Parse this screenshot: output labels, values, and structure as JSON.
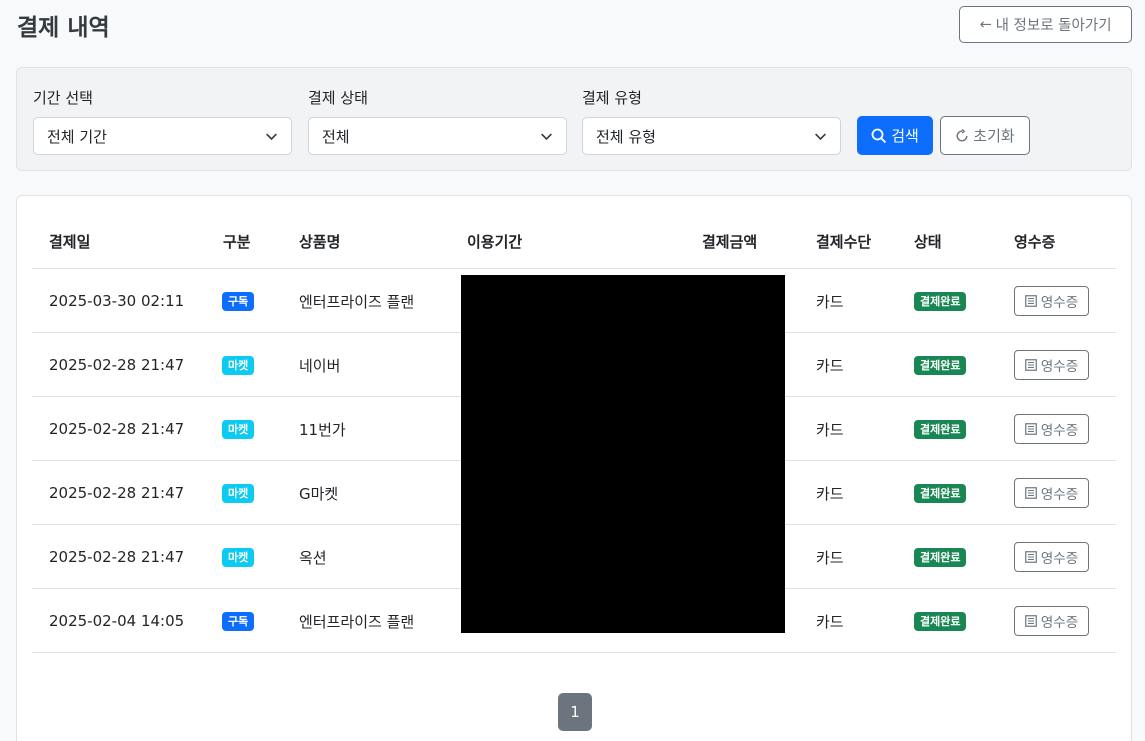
{
  "page": {
    "title": "결제 내역",
    "back_label": "내 정보로 돌아가기"
  },
  "filters": {
    "period": {
      "label": "기간 선택",
      "value": "전체 기간"
    },
    "status": {
      "label": "결제 상태",
      "value": "전체"
    },
    "type": {
      "label": "결제 유형",
      "value": "전체 유형"
    },
    "search_label": "검색",
    "reset_label": "초기화"
  },
  "table": {
    "headers": {
      "date": "결제일",
      "category": "구분",
      "product": "상품명",
      "period": "이용기간",
      "amount": "결제금액",
      "method": "결제수단",
      "status": "상태",
      "receipt": "영수증"
    },
    "rows": [
      {
        "date": "2025-03-30 02:11",
        "category": "구독",
        "product": "엔터프라이즈 플랜",
        "method": "카드",
        "status": "결제완료",
        "receipt": "영수증"
      },
      {
        "date": "2025-02-28 21:47",
        "category": "마켓",
        "product": "네이버",
        "method": "카드",
        "status": "결제완료",
        "receipt": "영수증"
      },
      {
        "date": "2025-02-28 21:47",
        "category": "마켓",
        "product": "11번가",
        "method": "카드",
        "status": "결제완료",
        "receipt": "영수증"
      },
      {
        "date": "2025-02-28 21:47",
        "category": "마켓",
        "product": "G마켓",
        "method": "카드",
        "status": "결제완료",
        "receipt": "영수증"
      },
      {
        "date": "2025-02-28 21:47",
        "category": "마켓",
        "product": "옥션",
        "method": "카드",
        "status": "결제완료",
        "receipt": "영수증"
      },
      {
        "date": "2025-02-04 14:05",
        "category": "구독",
        "product": "엔터프라이즈 플랜",
        "method": "카드",
        "status": "결제완료",
        "receipt": "영수증"
      }
    ]
  },
  "pagination": {
    "current": "1"
  },
  "colors": {
    "primary": "#0d6efd",
    "subscription_badge": "#0d6efd",
    "market_badge": "#0dcaf0",
    "success_badge": "#198754",
    "secondary": "#6c757d"
  }
}
